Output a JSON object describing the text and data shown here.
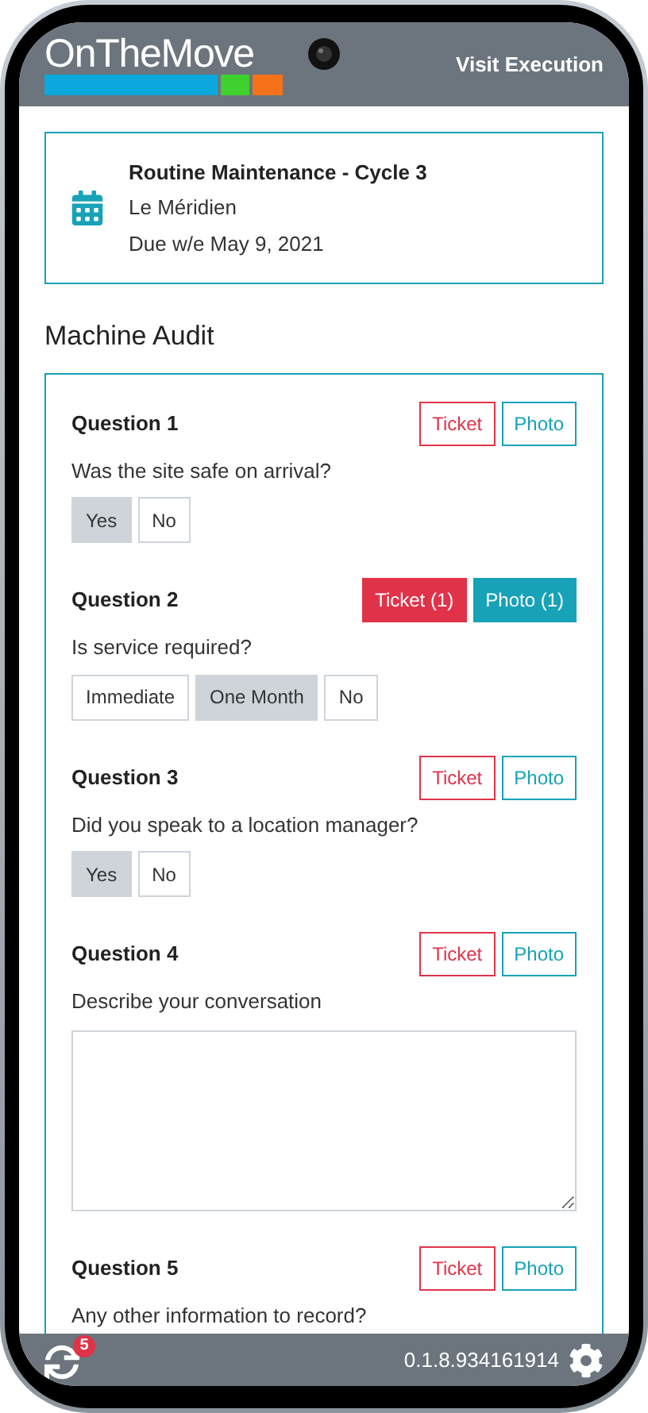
{
  "header": {
    "logo": "OnTheMove",
    "title": "Visit Execution"
  },
  "visit": {
    "title": "Routine Maintenance - Cycle 3",
    "location": "Le Méridien",
    "due": "Due w/e May 9, 2021"
  },
  "section_title": "Machine Audit",
  "questions": [
    {
      "title": "Question 1",
      "kind": "choice",
      "prompt": "Was the site safe on arrival?",
      "actions": [
        {
          "kind": "ticket",
          "label": "Ticket",
          "filled": false
        },
        {
          "kind": "photo",
          "label": "Photo",
          "filled": false
        }
      ],
      "options": [
        {
          "label": "Yes",
          "selected": true
        },
        {
          "label": "No",
          "selected": false
        }
      ]
    },
    {
      "title": "Question 2",
      "kind": "choice",
      "prompt": "Is service required?",
      "actions": [
        {
          "kind": "ticket",
          "label": "Ticket (1)",
          "filled": true
        },
        {
          "kind": "photo",
          "label": "Photo (1)",
          "filled": true
        }
      ],
      "options": [
        {
          "label": "Immediate",
          "selected": false
        },
        {
          "label": "One Month",
          "selected": true
        },
        {
          "label": "No",
          "selected": false
        }
      ]
    },
    {
      "title": "Question 3",
      "kind": "choice",
      "prompt": "Did you speak to a location manager?",
      "actions": [
        {
          "kind": "ticket",
          "label": "Ticket",
          "filled": false
        },
        {
          "kind": "photo",
          "label": "Photo",
          "filled": false
        }
      ],
      "options": [
        {
          "label": "Yes",
          "selected": true
        },
        {
          "label": "No",
          "selected": false
        }
      ]
    },
    {
      "title": "Question 4",
      "kind": "text",
      "prompt": "Describe your conversation",
      "actions": [
        {
          "kind": "ticket",
          "label": "Ticket",
          "filled": false
        },
        {
          "kind": "photo",
          "label": "Photo",
          "filled": false
        }
      ]
    },
    {
      "title": "Question 5",
      "kind": "label",
      "prompt": "Any other information to record?",
      "actions": [
        {
          "kind": "ticket",
          "label": "Ticket",
          "filled": false
        },
        {
          "kind": "photo",
          "label": "Photo",
          "filled": false
        }
      ]
    }
  ],
  "footer": {
    "sync_badge": "5",
    "version": "0.1.8.934161914"
  }
}
